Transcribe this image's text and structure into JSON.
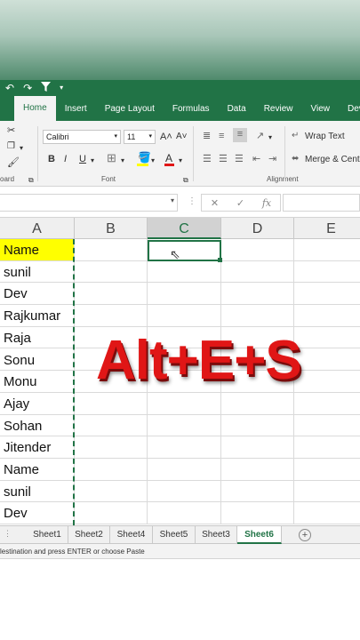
{
  "quick_access": {
    "undo_icon": "undo-icon",
    "redo_icon": "redo-icon",
    "filter_icon": "filter-icon"
  },
  "ribbon_tabs": [
    "Home",
    "Insert",
    "Page Layout",
    "Formulas",
    "Data",
    "Review",
    "View",
    "Devel"
  ],
  "ribbon": {
    "font_name": "Calibri",
    "font_size": "11",
    "bold": "B",
    "italic": "I",
    "underline": "U",
    "wrap_text": "Wrap Text",
    "merge_center": "Merge & Cente",
    "group_clipboard": "oard",
    "group_font": "Font",
    "group_alignment": "Alignment",
    "grow_font": "A˄",
    "shrink_font": "A˅",
    "font_color_letter": "A"
  },
  "formula_bar": {
    "cancel": "✕",
    "enter": "✓",
    "fx": "fx"
  },
  "columns": [
    "A",
    "B",
    "C",
    "D",
    "E"
  ],
  "cells": [
    "Name",
    "sunil",
    "Dev",
    "Rajkumar",
    "Raja",
    "Sonu",
    "Monu",
    "Ajay",
    "Sohan",
    "Jitender",
    "Name",
    "sunil",
    "Dev"
  ],
  "overlay_text": "Alt+E+S",
  "sheets": [
    "Sheet1",
    "Sheet2",
    "Sheet4",
    "Sheet5",
    "Sheet3",
    "Sheet6"
  ],
  "status_text": "lestination and press ENTER or choose Paste",
  "colors": {
    "excel_green": "#217346",
    "highlight_yellow": "#ffff00",
    "overlay_red": "#e01616"
  }
}
